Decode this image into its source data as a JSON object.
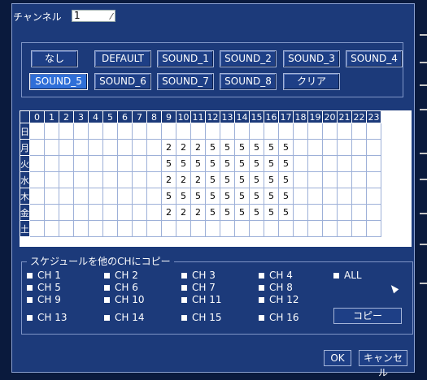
{
  "channel": {
    "label": "チャンネル",
    "value": "1"
  },
  "sound_buttons": [
    "なし",
    "DEFAULT",
    "SOUND_1",
    "SOUND_2",
    "SOUND_3",
    "SOUND_4",
    "SOUND_5",
    "SOUND_6",
    "SOUND_7",
    "SOUND_8",
    "クリア"
  ],
  "selected_sound": "SOUND_5",
  "schedule": {
    "hours": [
      "0",
      "1",
      "2",
      "3",
      "4",
      "5",
      "6",
      "7",
      "8",
      "9",
      "10",
      "11",
      "12",
      "13",
      "14",
      "15",
      "16",
      "17",
      "18",
      "19",
      "20",
      "21",
      "22",
      "23"
    ],
    "days": [
      "日",
      "月",
      "火",
      "水",
      "木",
      "金",
      "土"
    ],
    "rows": [
      [
        "",
        "",
        "",
        "",
        "",
        "",
        "",
        "",
        "",
        "",
        "",
        "",
        "",
        "",
        "",
        "",
        "",
        "",
        "",
        "",
        "",
        "",
        "",
        ""
      ],
      [
        "",
        "",
        "",
        "",
        "",
        "",
        "",
        "",
        "",
        "2",
        "2",
        "2",
        "5",
        "5",
        "5",
        "5",
        "5",
        "5",
        "",
        "",
        "",
        "",
        "",
        ""
      ],
      [
        "",
        "",
        "",
        "",
        "",
        "",
        "",
        "",
        "",
        "5",
        "5",
        "5",
        "5",
        "5",
        "5",
        "5",
        "5",
        "5",
        "",
        "",
        "",
        "",
        "",
        ""
      ],
      [
        "",
        "",
        "",
        "",
        "",
        "",
        "",
        "",
        "",
        "2",
        "2",
        "2",
        "5",
        "5",
        "5",
        "5",
        "5",
        "5",
        "",
        "",
        "",
        "",
        "",
        ""
      ],
      [
        "",
        "",
        "",
        "",
        "",
        "",
        "",
        "",
        "",
        "5",
        "5",
        "5",
        "5",
        "5",
        "5",
        "5",
        "5",
        "5",
        "",
        "",
        "",
        "",
        "",
        ""
      ],
      [
        "",
        "",
        "",
        "",
        "",
        "",
        "",
        "",
        "",
        "2",
        "2",
        "2",
        "5",
        "5",
        "5",
        "5",
        "5",
        "5",
        "",
        "",
        "",
        "",
        "",
        ""
      ],
      [
        "",
        "",
        "",
        "",
        "",
        "",
        "",
        "",
        "",
        "",
        "",
        "",
        "",
        "",
        "",
        "",
        "",
        "",
        "",
        "",
        "",
        "",
        "",
        ""
      ]
    ]
  },
  "copy": {
    "title": "スケジュールを他のCHにコピー",
    "channels": [
      "CH 1",
      "CH 2",
      "CH 3",
      "CH 4",
      "ALL",
      "CH 5",
      "CH 6",
      "CH 7",
      "CH 8",
      "CH 9",
      "CH 10",
      "CH 11",
      "CH 12",
      "CH 13",
      "CH 14",
      "CH 15",
      "CH 16"
    ],
    "copy_label": "コピー"
  },
  "footer": {
    "ok_label": "OK",
    "cancel_label": "キャンセル"
  }
}
